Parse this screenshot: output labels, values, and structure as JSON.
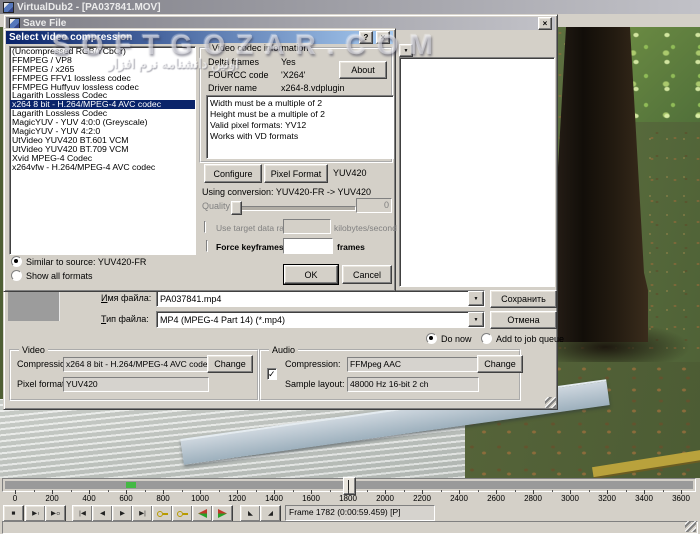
{
  "window": {
    "title": "VirtualDub2 - [PA037841.MOV]"
  },
  "icons": {
    "close_glyph": "×",
    "help_glyph": "?",
    "dropdown_glyph": "▼",
    "check_glyph": "✓"
  },
  "watermark": {
    "main": "SOFTGOZAR.COM",
    "sub": "اولین دانشنامه نرم افزار"
  },
  "save_file": {
    "title": "Save File",
    "filename_label": "Имя файла:",
    "filename_value": "PA037841.mp4",
    "filetype_label": "Тип файла:",
    "filetype_value": "MP4 (MPEG-4 Part 14) (*.mp4)",
    "save_button": "Сохранить",
    "cancel_button": "Отмена",
    "do_now_label": "Do now",
    "add_to_queue_label": "Add to job queue",
    "video_group": {
      "title": "Video",
      "compression_label": "Compression:",
      "compression_value": "x264 8 bit - H.264/MPEG-4 AVC codec",
      "change_button": "Change",
      "pixel_format_label": "Pixel format:",
      "pixel_format_value": "YUV420"
    },
    "audio_group": {
      "title": "Audio",
      "compression_label": "Compression:",
      "compression_value": "FFMpeg AAC",
      "change_button": "Change",
      "sample_layout_label": "Sample layout:",
      "sample_layout_value": "48000 Hz 16-bit 2 ch"
    }
  },
  "compression_dialog": {
    "title": "Select video compression",
    "codecs": [
      "(Uncompressed RGB/YCbCr)",
      "FFMPEG / VP8",
      "FFMPEG / x265",
      "FFMPEG FFV1 lossless codec",
      "FFMPEG Huffyuv lossless codec",
      "Lagarith Lossless Codec",
      "x264 8 bit - H.264/MPEG-4 AVC codec",
      "Lagarith Lossless Codec",
      "MagicYUV - YUV 4:0:0 (Greyscale)",
      "MagicYUV - YUV 4:2:0",
      "UtVideo YUV420 BT.601 VCM",
      "UtVideo YUV420 BT.709 VCM",
      "Xvid MPEG-4 Codec",
      "x264vfw - H.264/MPEG-4 AVC codec"
    ],
    "selected_index": 6,
    "similar_radio_label": "Similar to source: YUV420-FR",
    "show_all_radio_label": "Show all formats",
    "info_group": {
      "title": "Video codec information",
      "rows": [
        {
          "label": "Delta frames",
          "value": "Yes"
        },
        {
          "label": "FOURCC code",
          "value": "'X264'"
        },
        {
          "label": "Driver name",
          "value": "x264-8.vdplugin"
        }
      ],
      "about_button": "About",
      "notes": [
        "Width must be a multiple of 2",
        "Height must be a multiple of 2",
        "Valid pixel formats: YV12",
        "Works with VD formats"
      ]
    },
    "configure_button": "Configure",
    "pixel_format_button": "Pixel Format",
    "pixel_format_value": "YUV420",
    "conversion_text": "Using conversion: YUV420-FR -> YUV420",
    "quality_label": "Quality",
    "quality_value": "0",
    "target_rate_label": "Use target data rate of",
    "target_rate_unit": "kilobytes/second",
    "keyframes_label": "Force keyframes every",
    "keyframes_unit": "frames",
    "ok_button": "OK",
    "cancel_button": "Cancel"
  },
  "timeline": {
    "ruler_labels": [
      "0",
      "200",
      "400",
      "600",
      "800",
      "1000",
      "1200",
      "1400",
      "1600",
      "1800",
      "2000",
      "2200",
      "2400",
      "2600",
      "2800",
      "3000",
      "3200",
      "3400",
      "3600"
    ],
    "frame_info": "Frame 1782 (0:00:59.459) [P]",
    "toolbar": [
      {
        "name": "stop",
        "glyph": "■"
      },
      {
        "name": "play-input",
        "glyph": "▶",
        "sub": "I"
      },
      {
        "name": "play-output",
        "glyph": "▶",
        "sub": "O"
      },
      {
        "name": "go-to-start",
        "glyph": "|◀"
      },
      {
        "name": "frame-back",
        "glyph": "◀"
      },
      {
        "name": "frame-forward",
        "glyph": "▶"
      },
      {
        "name": "go-to-end",
        "glyph": "▶|"
      },
      {
        "name": "prev-keyframe",
        "type": "key"
      },
      {
        "name": "next-keyframe",
        "type": "key"
      },
      {
        "name": "prev-scene",
        "type": "scene-left"
      },
      {
        "name": "next-scene",
        "type": "scene-right"
      },
      {
        "name": "mark-in",
        "glyph": "◣"
      },
      {
        "name": "mark-out",
        "glyph": "◢"
      }
    ]
  },
  "colors": {
    "face": "#d4d0c8",
    "selection": "#0a246a",
    "active_title_start": "#0a246a",
    "active_title_end": "#a6caf0",
    "keyframe_icon": "#b89a00",
    "scene_red": "#c03828",
    "scene_green": "#28a028",
    "timeline_marker_green": "#44b944"
  }
}
